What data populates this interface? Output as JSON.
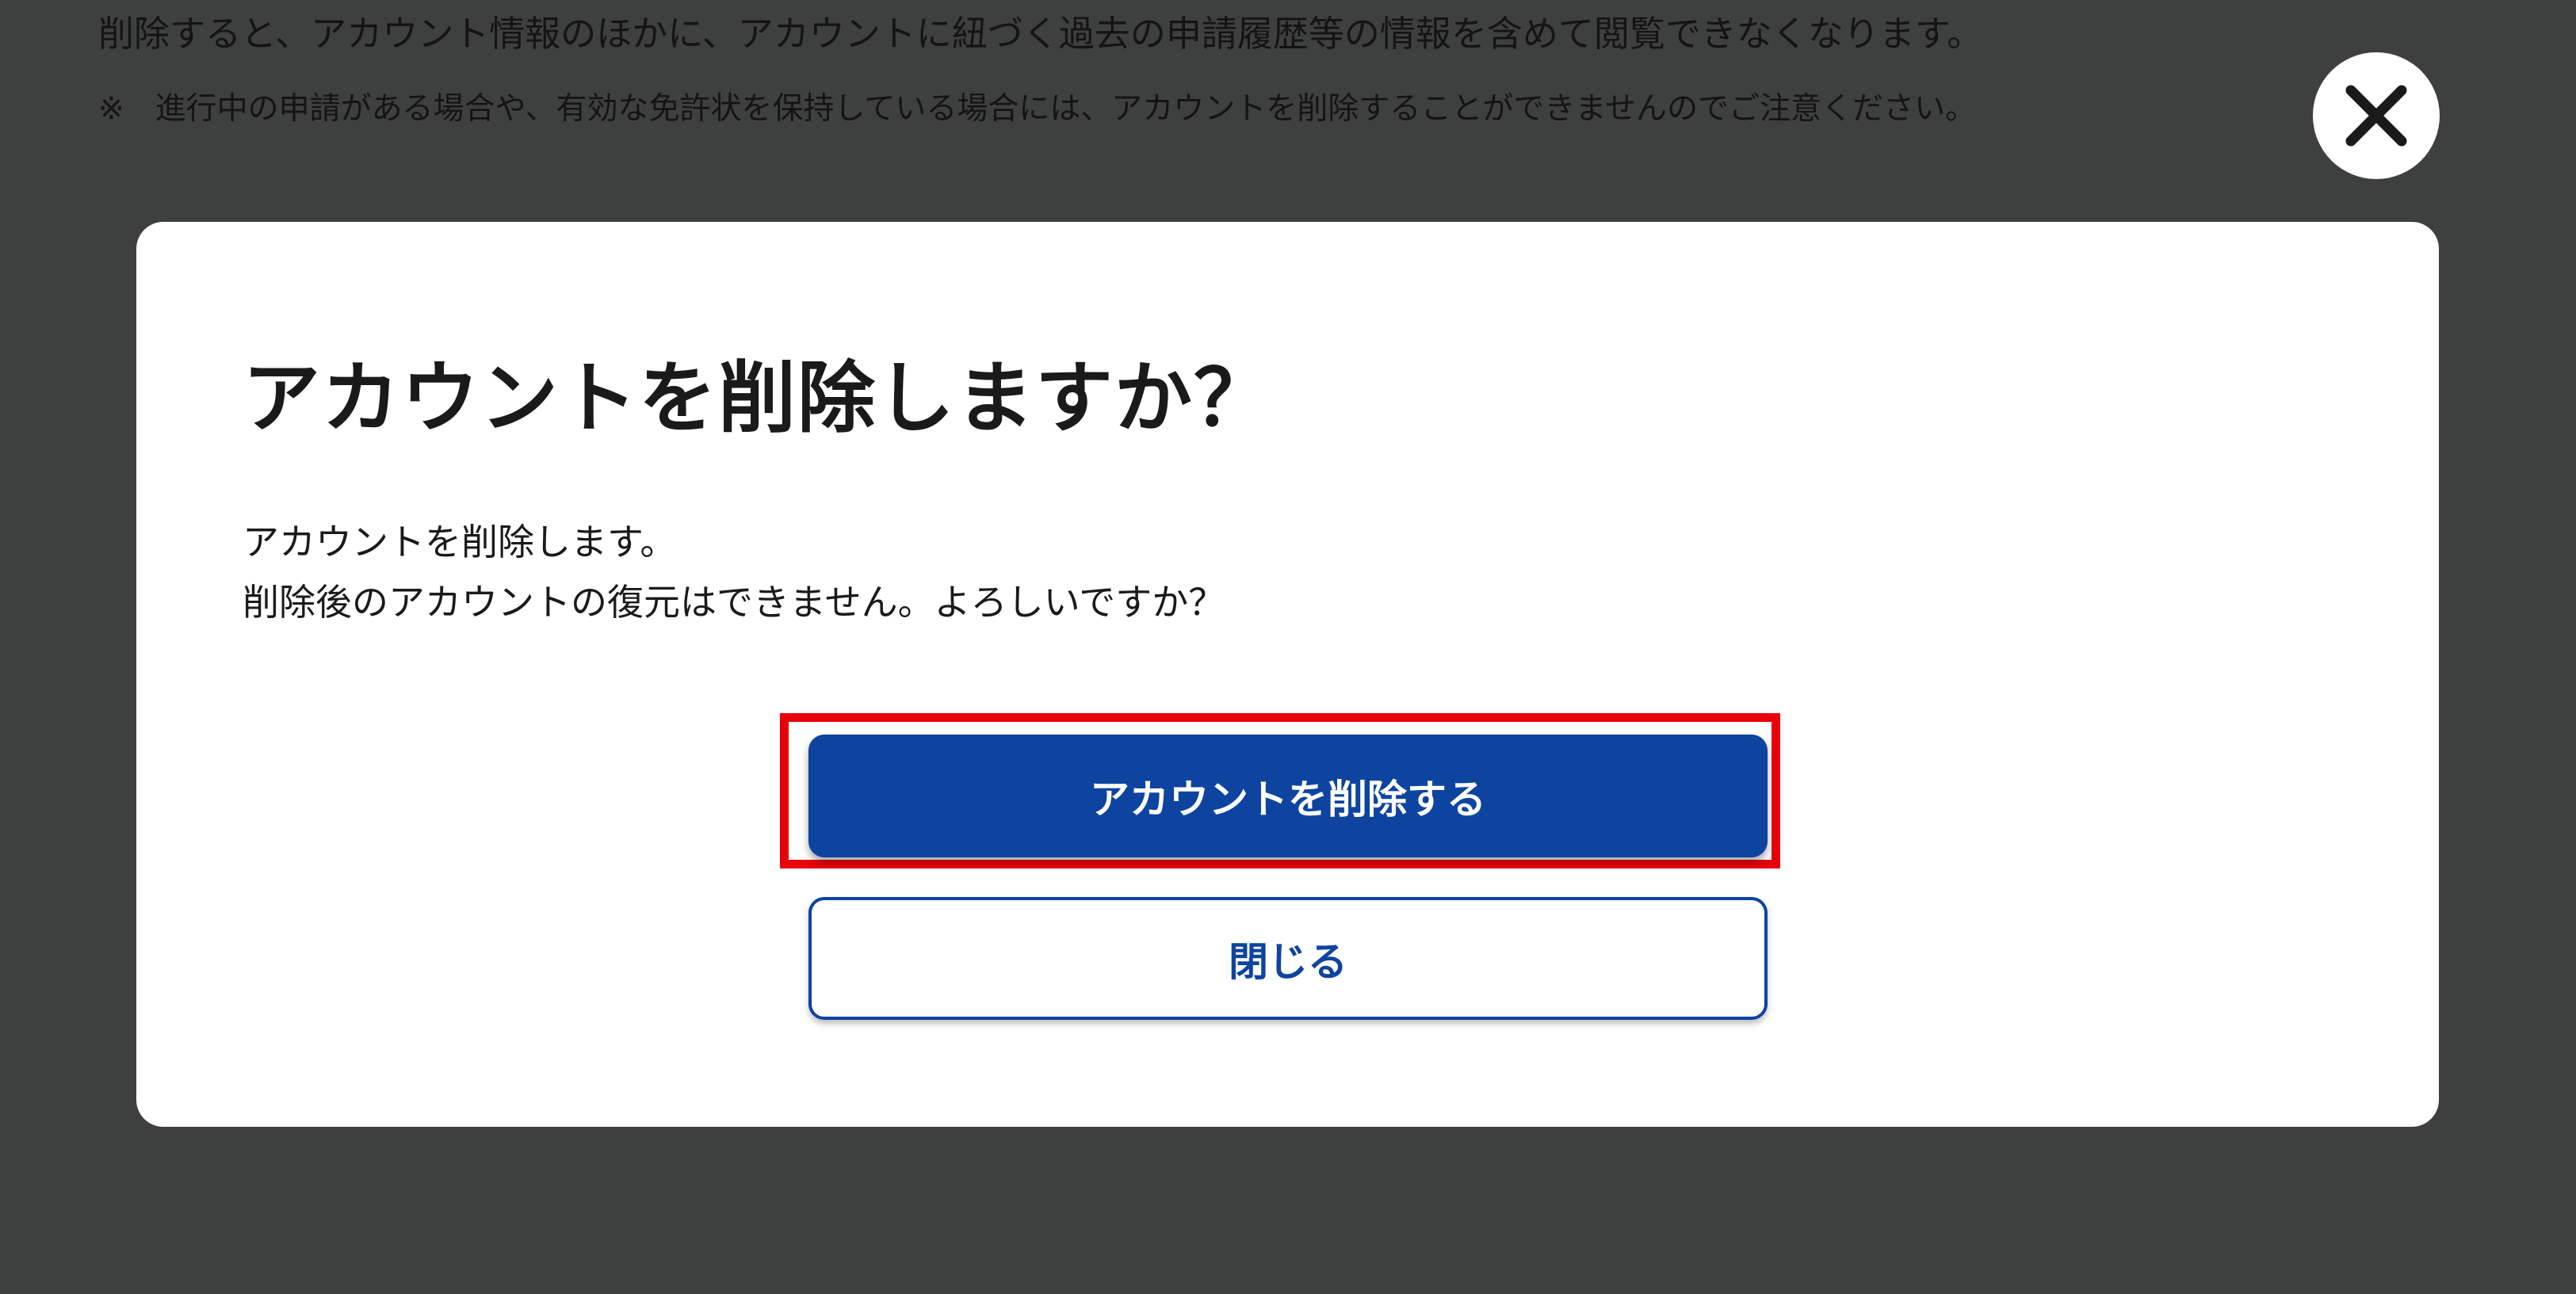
{
  "background": {
    "notice_line_1": "削除すると、アカウント情報のほかに、アカウントに紐づく過去の申請履歴等の情報を含めて閲覧できなくなります。",
    "notice_line_2": "※　進行中の申請がある場合や、有効な免許状を保持している場合には、アカウントを削除することができませんのでご注意ください。"
  },
  "overlay_close": {
    "icon": "close-icon"
  },
  "dialog": {
    "title": "アカウントを削除しますか？",
    "body_line_1": "アカウントを削除します。",
    "body_line_2": "削除後のアカウントの復元はできません。よろしいですか？",
    "delete_button_label": "アカウントを削除する",
    "close_button_label": "閉じる"
  },
  "colors": {
    "primary": "#0d44a0",
    "highlight": "#e8000b",
    "backdrop": "#3e3f3f"
  }
}
